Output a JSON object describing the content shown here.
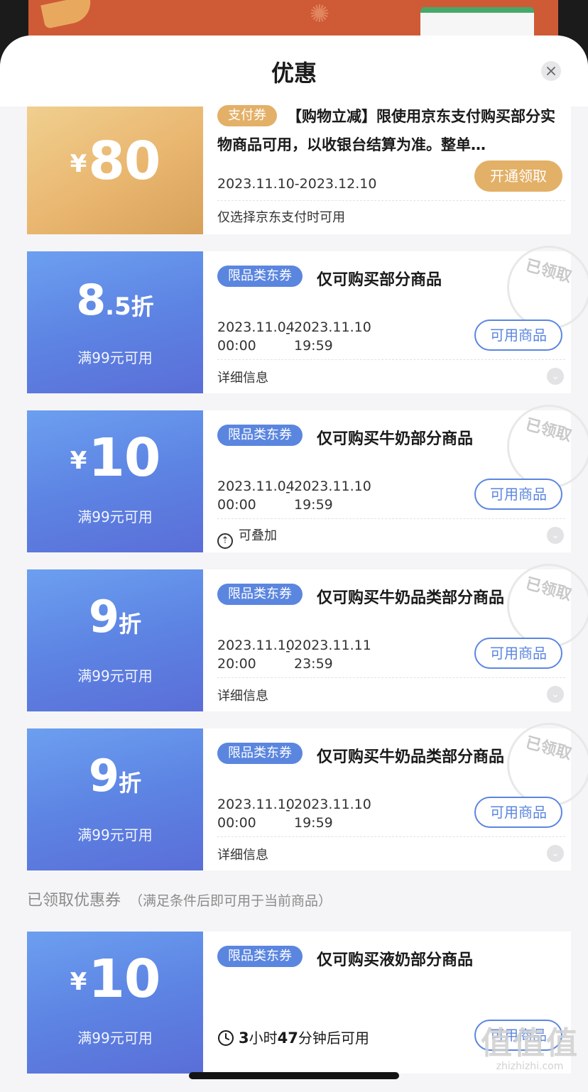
{
  "sheet": {
    "title": "优惠"
  },
  "coupons": [
    {
      "currency": "¥",
      "amount": "80",
      "tag": "支付券",
      "description": "【购物立减】限使用京东支付购买部分实物商品可用，以收银台结算为准。整单…",
      "date_range": "2023.11.10-2023.12.10",
      "action": "开通领取",
      "footer": "仅选择京东支付时可用"
    },
    {
      "amount_main": "8",
      "amount_small": ".5",
      "unit": "折",
      "condition": "满99元可用",
      "tag": "限品类东券",
      "title": "仅可购买部分商品",
      "start_date": "2023.11.04",
      "start_time": "00:00",
      "end_date": "2023.11.10",
      "end_time": "19:59",
      "action": "可用商品",
      "footer": "详细信息",
      "stamp": "已领取"
    },
    {
      "currency": "¥",
      "amount": "10",
      "condition": "满99元可用",
      "tag": "限品类东券",
      "title": "仅可购买牛奶部分商品",
      "start_date": "2023.11.04",
      "start_time": "00:00",
      "end_date": "2023.11.10",
      "end_time": "19:59",
      "action": "可用商品",
      "footer": "可叠加",
      "stamp": "已领取"
    },
    {
      "amount": "9",
      "unit": "折",
      "condition": "满99元可用",
      "tag": "限品类东券",
      "title": "仅可购买牛奶品类部分商品",
      "start_date": "2023.11.10",
      "start_time": "20:00",
      "end_date": "2023.11.11",
      "end_time": "23:59",
      "action": "可用商品",
      "footer": "详细信息",
      "stamp": "已领取"
    },
    {
      "amount": "9",
      "unit": "折",
      "condition": "满99元可用",
      "tag": "限品类东券",
      "title": "仅可购买牛奶品类部分商品",
      "start_date": "2023.11.10",
      "start_time": "00:00",
      "end_date": "2023.11.10",
      "end_time": "19:59",
      "action": "可用商品",
      "footer": "详细信息",
      "stamp": "已领取"
    },
    {
      "currency": "¥",
      "amount": "10",
      "condition": "满99元可用",
      "tag": "限品类东券",
      "title": "仅可购买液奶部分商品",
      "wait_hours": "3",
      "wait_hours_label": "小时",
      "wait_minutes": "47",
      "wait_minutes_label": "分钟后可用",
      "action": "可用商品"
    }
  ],
  "section": {
    "title": "已领取优惠券",
    "subtitle": "（满足条件后即可用于当前商品）"
  },
  "date_separator": "-",
  "watermark": {
    "logo": "值值值",
    "url": "zhizhizhi.com"
  },
  "colors": {
    "gold": "#e3b067",
    "blue": "#5b86df",
    "blue_gradient_end": "#5a6ed8"
  }
}
